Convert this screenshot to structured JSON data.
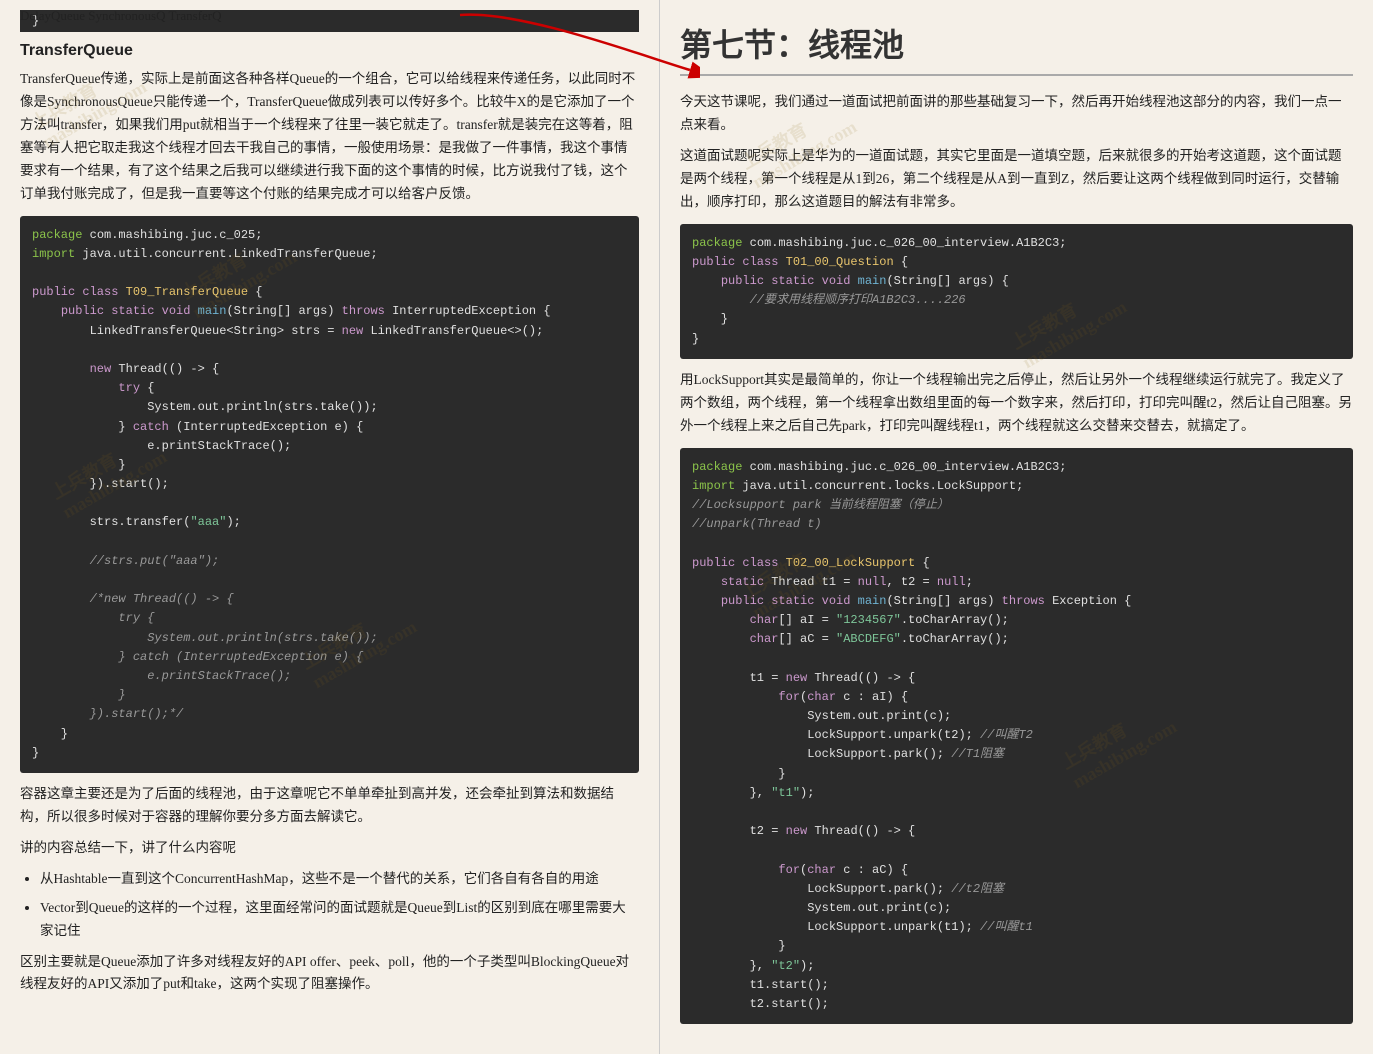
{
  "left": {
    "closing_brace": "}",
    "transferqueue_title": "TransferQueue",
    "transferqueue_desc1": "TransferQueue传递，实际上是前面这各种各样Queue的一个组合，它可以给线程来传递任务，以此同时不像是SynchronousQueue只能传递一个，TransferQueue做成列表可以传好多个。比较牛X的是它添加了一个方法叫transfer，如果我们用put就相当于一个线程来了往里一装它就走了。transfer就是装完在这等着，阻塞等有人把它取走我这个线程才回去干我自己的事情，一般使用场景：是我做了一件事情，我这个事情要求有一个结果，有了这个结果之后我可以继续进行我下面的这个事情的时候，比方说我付了钱，这个订单我付账完成了，但是我一直要等这个付账的结果完成才可以给客户反馈。",
    "code1_lines": [
      "package com.mashibing.juc.c_025;",
      "import java.util.concurrent.LinkedTransferQueue;",
      "",
      "public class T09_TransferQueue {",
      "    public static void main(String[] args) throws InterruptedException {",
      "        LinkedTransferQueue<String> strs = new LinkedTransferQueue<>();",
      "",
      "        new Thread(() -> {",
      "            try {",
      "                System.out.println(strs.take());",
      "            } catch (InterruptedException e) {",
      "                e.printStackTrace();",
      "            }",
      "        }).start();",
      "",
      "        strs.transfer(\"aaa\");",
      "",
      "        //strs.put(\"aaa\");",
      "",
      "        /*new Thread(() -> {",
      "            try {",
      "                System.out.println(strs.take());",
      "            } catch (InterruptedException e) {",
      "                e.printStackTrace();",
      "            }",
      "        }).start();*/",
      "    }",
      "}"
    ],
    "summary_title": "容器这章主要还是为了后面的线程池，由于这章呢它不单单牵扯到高并发，还会牵扯到算法和数据结构，所以很多时候对于容器的理解你要分多方面去解读它。",
    "summary_title2": "讲的内容总结一下，讲了什么内容呢",
    "bullets": [
      "从Hashtable一直到这个ConcurrentHashMap，这些不是一个替代的关系，它们各自有各自的用途",
      "Vector到Queue的这样的一个过程，这里面经常问的面试题就是Queue到List的区别到底在哪里需要大家记住"
    ],
    "sub_text": "区别主要就是Queue添加了许多对线程友好的API offer、peek、poll，他的一个子类型叫BlockingQueue对线程友好的API又添加了put和take，这两个实现了阻塞操作。",
    "bullet3_prefix": "• ",
    "delayqueue_text": "DelayQueue  SynchronousQ  TransferQ"
  },
  "right": {
    "section_title": "第七节：线程池",
    "intro1": "今天这节课呢，我们通过一道面试把前面讲的那些基础复习一下，然后再开始线程池这部分的内容，我们一点一点来看。",
    "intro2": "这道面试题呢实际上是华为的一道面试题，其实它里面是一道填空题，后来就很多的开始考这道题，这个面试题是两个线程，第一个线程是从1到26，第二个线程是从A到一直到Z，然后要让这两个线程做到同时运行，交替输出，顺序打印，那么这道题目的解法有非常多。",
    "code2_lines": [
      "package com.mashibing.juc.c_026_00_interview.A1B2C3;",
      "public class T01_00_Question {",
      "    public static void main(String[] args) {",
      "        //要求用线程顺序打印A1B2C3....226",
      "    }",
      "}"
    ],
    "locksupport_desc": "用LockSupport其实是最简单的，你让一个线程输出完之后停止，然后让另外一个线程继续运行就完了。我定义了两个数组，两个线程，第一个线程拿出数组里面的每一个数字来，然后打印，打印完叫醒t2，然后让自己阻塞。另外一个线程上来之后自己先park，打印完叫醒线程t1，两个线程就这么交替来交替去，就搞定了。",
    "code3_lines": [
      "package com.mashibing.juc.c_026_00_interview.A1B2C3;",
      "import java.util.concurrent.locks.LockSupport;",
      "//Locksupport park 当前线程阻塞（停止）",
      "//unpark(Thread t)",
      "",
      "public class T02_00_LockSupport {",
      "    static Thread t1 = null, t2 = null;",
      "    public static void main(String[] args) throws Exception {",
      "        char[] aI = \"1234567\".toCharArray();",
      "        char[] aC = \"ABCDEFG\".toCharArray();",
      "",
      "        t1 = new Thread(() -> {",
      "            for(char c : aI) {",
      "                System.out.print(c);",
      "                LockSupport.unpark(t2); //叫醒T2",
      "                LockSupport.park(); //T1阻塞",
      "            }",
      "        }, \"t1\");",
      "",
      "        t2 = new Thread(() -> {",
      "",
      "            for(char c : aC) {",
      "                LockSupport.park(); //t2阻塞",
      "                System.out.print(c);",
      "                LockSupport.unpark(t1); //叫醒t1",
      "            }",
      "        }, \"t2\");",
      "        t1.start();",
      "        t2.start();"
    ]
  }
}
